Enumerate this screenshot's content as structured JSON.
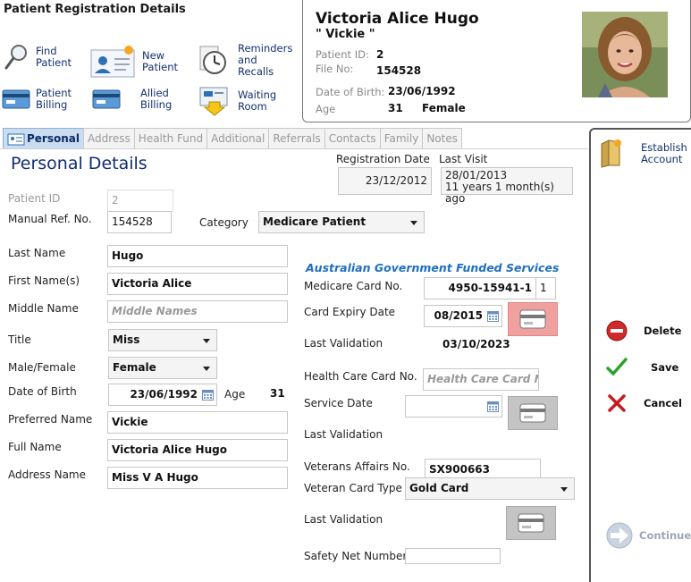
{
  "header": {
    "title": "Patient Registration Details",
    "actions": {
      "find": "Find\nPatient",
      "new": "New\nPatient",
      "reminders": "Reminders\nand\nRecalls",
      "billing": "Patient\nBilling",
      "allied": "Allied\nBilling",
      "waiting": "Waiting\nRoom"
    }
  },
  "patient_card": {
    "name": "Victoria Alice Hugo",
    "nickname": "\" Vickie \"",
    "patient_id_label": "Patient ID:",
    "patient_id": "2",
    "file_no_label": "File No:",
    "file_no": "154528",
    "dob_label": "Date of Birth:",
    "dob": "23/06/1992",
    "age_label": "Age",
    "age": "31",
    "sex": "Female"
  },
  "tabs": [
    "Personal",
    "Address",
    "Health Fund",
    "Additional",
    "Referrals",
    "Contacts",
    "Family",
    "Notes"
  ],
  "personal": {
    "section_title": "Personal Details",
    "registration_date_label": "Registration Date",
    "registration_date": "23/12/2012",
    "last_visit_label": "Last Visit",
    "last_visit_date": "28/01/2013",
    "last_visit_ago": "11 years 1 month(s) ago",
    "patient_id_label": "Patient ID",
    "patient_id": "2",
    "manual_ref_label": "Manual Ref. No.",
    "manual_ref": "154528",
    "category_label": "Category",
    "category": "Medicare Patient",
    "last_name_label": "Last Name",
    "last_name": "Hugo",
    "first_name_label": "First Name(s)",
    "first_name": "Victoria Alice",
    "middle_name_label": "Middle Name",
    "middle_name_placeholder": "Middle Names",
    "title_label": "Title",
    "title": "Miss",
    "sex_label": "Male/Female",
    "sex": "Female",
    "dob_label": "Date of Birth",
    "dob": "23/06/1992",
    "age_label": "Age",
    "age": "31",
    "preferred_name_label": "Preferred Name",
    "preferred_name": "Vickie",
    "full_name_label": "Full Name",
    "full_name": "Victoria Alice Hugo",
    "address_name_label": "Address Name",
    "address_name": "Miss V A Hugo"
  },
  "gov_services": {
    "title": "Australian Government Funded Services",
    "medicare_label": "Medicare Card No.",
    "medicare_no": "4950-15941-1",
    "medicare_irn": "1",
    "expiry_label": "Card Expiry Date",
    "expiry": "08/2015",
    "last_validation_label": "Last Validation",
    "medicare_last_validation": "03/10/2023",
    "hc_label": "Health Care Card No.",
    "hc_placeholder": "Health Care Card No",
    "service_date_label": "Service Date",
    "service_date": "",
    "dva_label": "Veterans Affairs No.",
    "dva_no": "SX900663",
    "vet_type_label": "Veteran Card Type",
    "vet_type": "Gold Card",
    "safety_net_label": "Safety Net Number",
    "safety_net": ""
  },
  "side_actions": {
    "establish": "Establish\nAccount",
    "delete": "Delete",
    "save": "Save",
    "cancel": "Cancel",
    "continue": "Continue"
  },
  "colors": {
    "accent": "#142c74",
    "gov_title": "#1f6fc1",
    "tab_active": "#c9dcf0",
    "card_alert": "#f1a0a0"
  }
}
